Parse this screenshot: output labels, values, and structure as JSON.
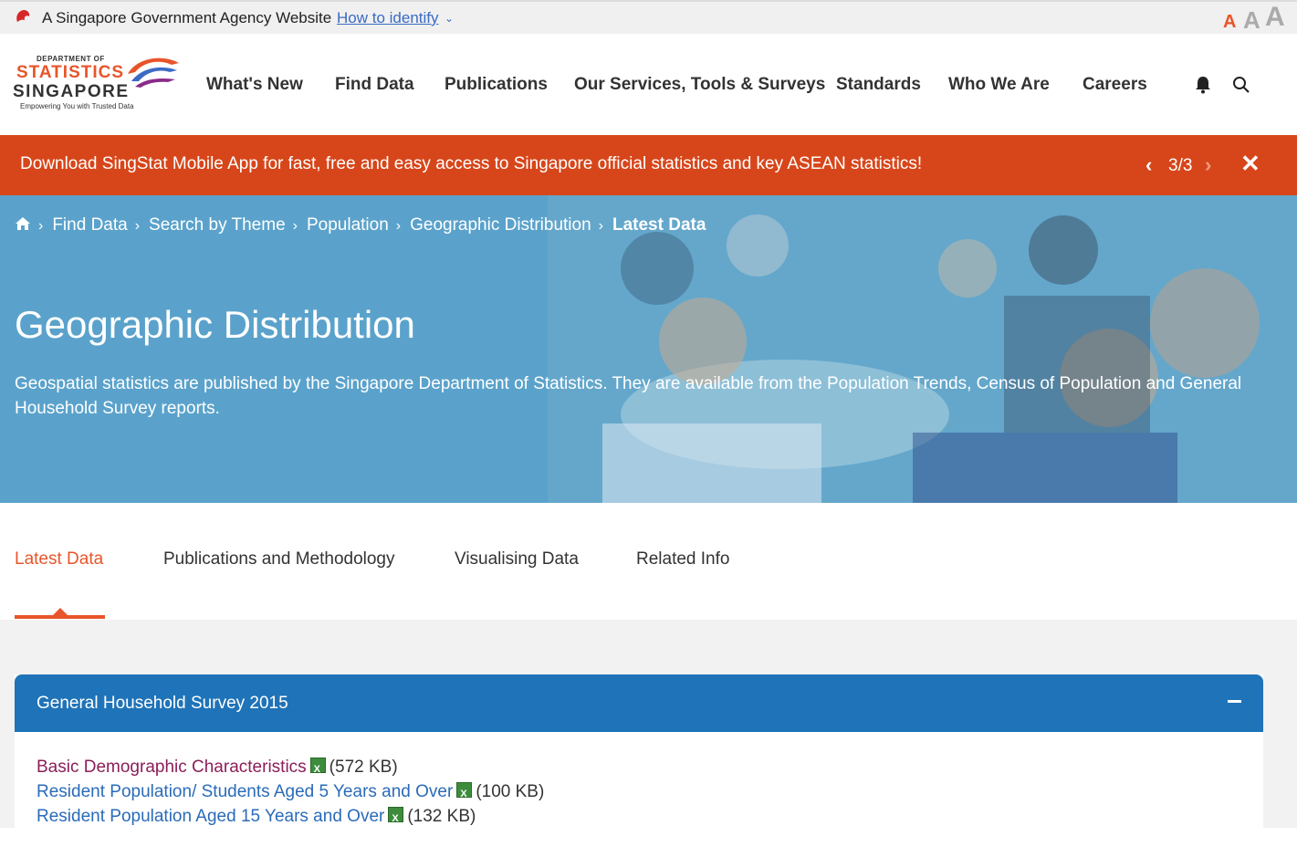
{
  "masthead": {
    "gov_text": "A Singapore Government Agency Website",
    "identify_label": "How to identify",
    "font_small": "A",
    "font_medium": "A",
    "font_large": "A"
  },
  "logo": {
    "line1": "DEPARTMENT OF",
    "line2": "STATISTICS",
    "line3": "SINGAPORE",
    "tagline": "Empowering You with Trusted Data"
  },
  "nav": {
    "items": [
      {
        "label": "What's New"
      },
      {
        "label": "Find Data"
      },
      {
        "label": "Publications"
      },
      {
        "label": "Our Services, Tools & Surveys"
      },
      {
        "label": "Standards"
      },
      {
        "label": "Who We Are"
      },
      {
        "label": "Careers"
      }
    ],
    "icons": [
      "bell-icon",
      "search-icon"
    ]
  },
  "banner": {
    "message": "Download SingStat Mobile App for fast, free and easy access to Singapore official statistics and key ASEAN statistics!",
    "counter": "3/3",
    "prev_icon": "chevron-left-icon",
    "next_icon": "chevron-right-icon",
    "close_icon": "close-icon"
  },
  "breadcrumb": {
    "items": [
      "Find Data",
      "Search by Theme",
      "Population",
      "Geographic Distribution"
    ],
    "current": "Latest Data"
  },
  "hero": {
    "title": "Geographic Distribution",
    "description": "Geospatial statistics are published by the Singapore Department of Statistics. They are available from the Population Trends, Census of Population and General Household Survey reports."
  },
  "tabs": {
    "items": [
      {
        "label": "Latest Data",
        "active": true
      },
      {
        "label": "Publications and Methodology",
        "active": false
      },
      {
        "label": "Visualising Data",
        "active": false
      },
      {
        "label": "Related Info",
        "active": false
      }
    ]
  },
  "panel": {
    "title": "General Household Survey 2015",
    "links": [
      {
        "label": "Basic Demographic Characteristics",
        "size": "(572 KB)",
        "visited": true
      },
      {
        "label": "Resident Population/ Students Aged 5 Years and Over",
        "size": "(100 KB)",
        "visited": false
      },
      {
        "label": "Resident Population Aged 15 Years and Over",
        "size": "(132 KB)",
        "visited": false
      }
    ]
  },
  "colors": {
    "accent": "#e8552a",
    "banner": "#d7461a",
    "panel_header": "#1f73b8",
    "link": "#2a6bb8",
    "visited_link": "#8b1e5a"
  }
}
